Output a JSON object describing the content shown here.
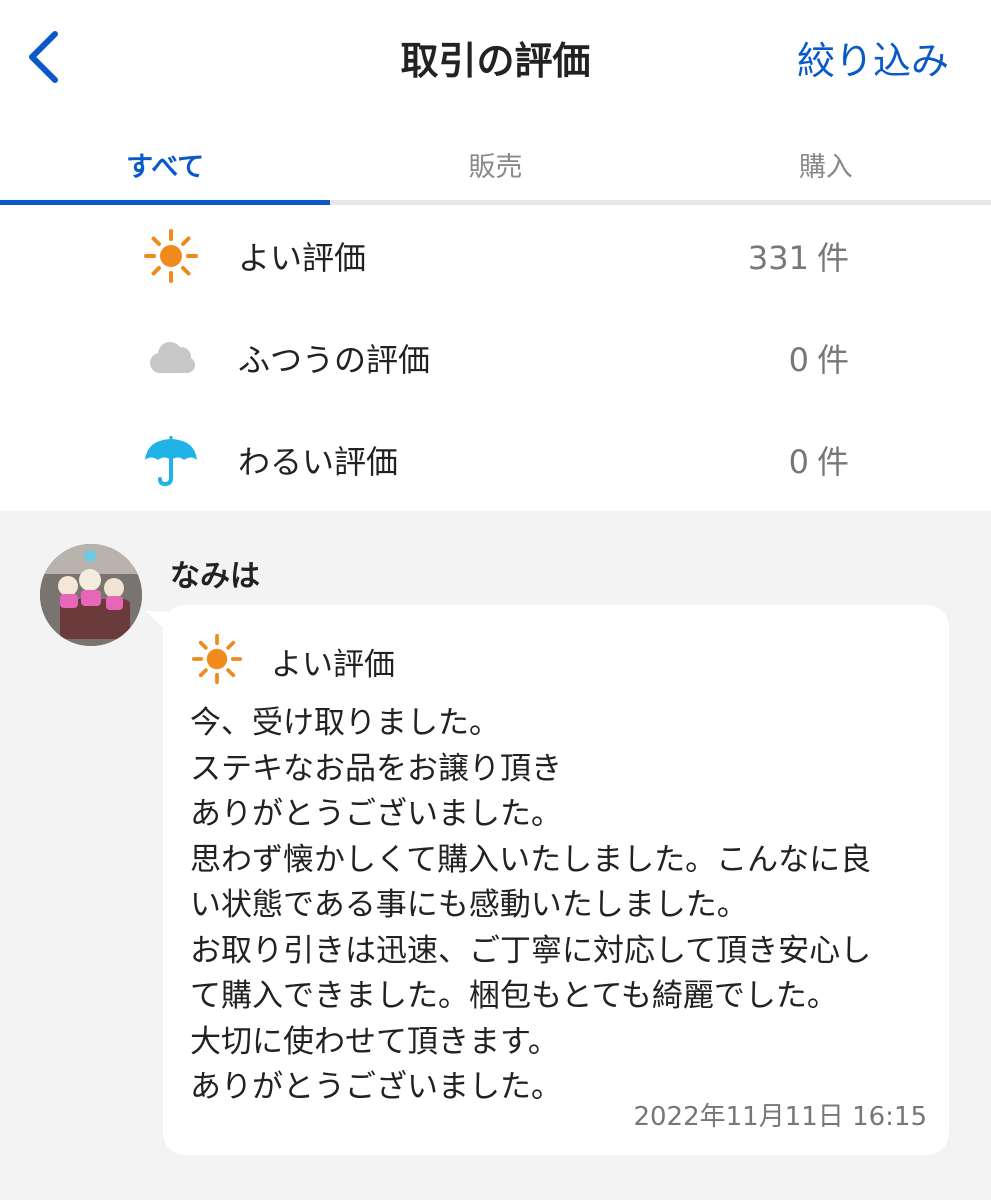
{
  "header": {
    "title": "取引の評価",
    "filter_label": "絞り込み"
  },
  "tabs": [
    {
      "label": "すべて",
      "active": true
    },
    {
      "label": "販売",
      "active": false
    },
    {
      "label": "購入",
      "active": false
    }
  ],
  "summary": [
    {
      "icon": "sun-icon",
      "label": "よい評価",
      "count": "331",
      "unit": "件"
    },
    {
      "icon": "cloud-icon",
      "label": "ふつうの評価",
      "count": "0",
      "unit": "件"
    },
    {
      "icon": "umbrella-icon",
      "label": "わるい評価",
      "count": "0",
      "unit": "件"
    }
  ],
  "review": {
    "reviewer": "なみは",
    "rating_label": "よい評価",
    "comment_lines": [
      "今、受け取りました。",
      "ステキなお品をお譲り頂き",
      "ありがとうございました。",
      "思わず懐かしくて購入いたしました。こんなに良",
      "い状態である事にも感動いたしました。",
      "お取り引きは迅速、ご丁寧に対応して頂き安心し",
      "て購入できました。梱包もとても綺麗でした。",
      "大切に使わせて頂きます。",
      "ありがとうございました。"
    ],
    "date": "2022年11月11日 16:15"
  },
  "colors": {
    "accent": "#0a59c9",
    "sun": "#f08a1c",
    "cloud": "#c7c7c7",
    "umbrella": "#1fb3e8"
  }
}
